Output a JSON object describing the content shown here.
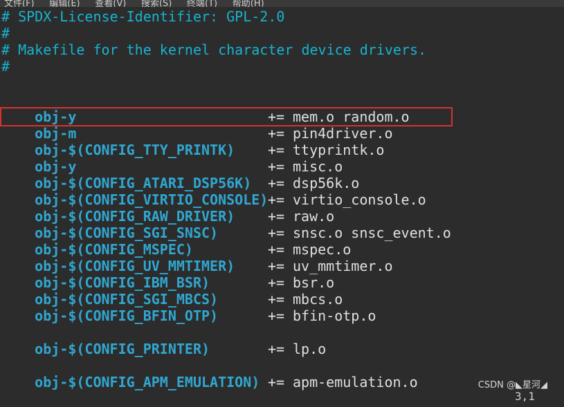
{
  "menubar": {
    "items": [
      "文件(F)",
      "编辑(E)",
      "查看(V)",
      "搜索(S)",
      "终端(T)",
      "帮助(H)"
    ]
  },
  "comments": [
    "# SPDX-License-Identifier: GPL-2.0",
    "#",
    "# Makefile for the kernel character device drivers.",
    "#"
  ],
  "rules": [
    {
      "var": "obj-y",
      "op": "+=",
      "value": "mem.o random.o"
    },
    {
      "var": "obj-m",
      "op": "+=",
      "value": "pin4driver.o"
    },
    {
      "var": "obj-$(CONFIG_TTY_PRINTK)",
      "op": "+=",
      "value": "ttyprintk.o"
    },
    {
      "var": "obj-y",
      "op": "+=",
      "value": "misc.o"
    },
    {
      "var": "obj-$(CONFIG_ATARI_DSP56K)",
      "op": "+=",
      "value": "dsp56k.o"
    },
    {
      "var": "obj-$(CONFIG_VIRTIO_CONSOLE)",
      "op": "+=",
      "value": "virtio_console.o"
    },
    {
      "var": "obj-$(CONFIG_RAW_DRIVER)",
      "op": "+=",
      "value": "raw.o"
    },
    {
      "var": "obj-$(CONFIG_SGI_SNSC)",
      "op": "+=",
      "value": "snsc.o snsc_event.o"
    },
    {
      "var": "obj-$(CONFIG_MSPEC)",
      "op": "+=",
      "value": "mspec.o"
    },
    {
      "var": "obj-$(CONFIG_UV_MMTIMER)",
      "op": "+=",
      "value": "uv_mmtimer.o"
    },
    {
      "var": "obj-$(CONFIG_IBM_BSR)",
      "op": "+=",
      "value": "bsr.o"
    },
    {
      "var": "obj-$(CONFIG_SGI_MBCS)",
      "op": "+=",
      "value": "mbcs.o"
    },
    {
      "var": "obj-$(CONFIG_BFIN_OTP)",
      "op": "+=",
      "value": "bfin-otp.o"
    },
    {
      "var": "obj-$(CONFIG_PRINTER)",
      "op": "+=",
      "value": "lp.o"
    },
    {
      "var": "obj-$(CONFIG_APM_EMULATION)",
      "op": "+=",
      "value": "apm-emulation.o"
    }
  ],
  "watermark": "CSDN @◣星河◢",
  "status_peek": "3,1"
}
